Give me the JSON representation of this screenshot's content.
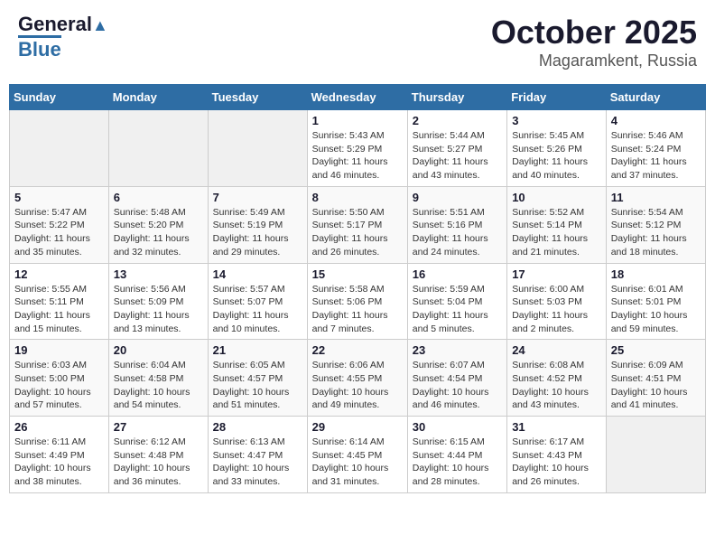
{
  "header": {
    "logo_general": "General",
    "logo_blue": "Blue",
    "title": "October 2025",
    "subtitle": "Magaramkent, Russia"
  },
  "days_of_week": [
    "Sunday",
    "Monday",
    "Tuesday",
    "Wednesday",
    "Thursday",
    "Friday",
    "Saturday"
  ],
  "weeks": [
    [
      {
        "day": "",
        "info": ""
      },
      {
        "day": "",
        "info": ""
      },
      {
        "day": "",
        "info": ""
      },
      {
        "day": "1",
        "info": "Sunrise: 5:43 AM\nSunset: 5:29 PM\nDaylight: 11 hours and 46 minutes."
      },
      {
        "day": "2",
        "info": "Sunrise: 5:44 AM\nSunset: 5:27 PM\nDaylight: 11 hours and 43 minutes."
      },
      {
        "day": "3",
        "info": "Sunrise: 5:45 AM\nSunset: 5:26 PM\nDaylight: 11 hours and 40 minutes."
      },
      {
        "day": "4",
        "info": "Sunrise: 5:46 AM\nSunset: 5:24 PM\nDaylight: 11 hours and 37 minutes."
      }
    ],
    [
      {
        "day": "5",
        "info": "Sunrise: 5:47 AM\nSunset: 5:22 PM\nDaylight: 11 hours and 35 minutes."
      },
      {
        "day": "6",
        "info": "Sunrise: 5:48 AM\nSunset: 5:20 PM\nDaylight: 11 hours and 32 minutes."
      },
      {
        "day": "7",
        "info": "Sunrise: 5:49 AM\nSunset: 5:19 PM\nDaylight: 11 hours and 29 minutes."
      },
      {
        "day": "8",
        "info": "Sunrise: 5:50 AM\nSunset: 5:17 PM\nDaylight: 11 hours and 26 minutes."
      },
      {
        "day": "9",
        "info": "Sunrise: 5:51 AM\nSunset: 5:16 PM\nDaylight: 11 hours and 24 minutes."
      },
      {
        "day": "10",
        "info": "Sunrise: 5:52 AM\nSunset: 5:14 PM\nDaylight: 11 hours and 21 minutes."
      },
      {
        "day": "11",
        "info": "Sunrise: 5:54 AM\nSunset: 5:12 PM\nDaylight: 11 hours and 18 minutes."
      }
    ],
    [
      {
        "day": "12",
        "info": "Sunrise: 5:55 AM\nSunset: 5:11 PM\nDaylight: 11 hours and 15 minutes."
      },
      {
        "day": "13",
        "info": "Sunrise: 5:56 AM\nSunset: 5:09 PM\nDaylight: 11 hours and 13 minutes."
      },
      {
        "day": "14",
        "info": "Sunrise: 5:57 AM\nSunset: 5:07 PM\nDaylight: 11 hours and 10 minutes."
      },
      {
        "day": "15",
        "info": "Sunrise: 5:58 AM\nSunset: 5:06 PM\nDaylight: 11 hours and 7 minutes."
      },
      {
        "day": "16",
        "info": "Sunrise: 5:59 AM\nSunset: 5:04 PM\nDaylight: 11 hours and 5 minutes."
      },
      {
        "day": "17",
        "info": "Sunrise: 6:00 AM\nSunset: 5:03 PM\nDaylight: 11 hours and 2 minutes."
      },
      {
        "day": "18",
        "info": "Sunrise: 6:01 AM\nSunset: 5:01 PM\nDaylight: 10 hours and 59 minutes."
      }
    ],
    [
      {
        "day": "19",
        "info": "Sunrise: 6:03 AM\nSunset: 5:00 PM\nDaylight: 10 hours and 57 minutes."
      },
      {
        "day": "20",
        "info": "Sunrise: 6:04 AM\nSunset: 4:58 PM\nDaylight: 10 hours and 54 minutes."
      },
      {
        "day": "21",
        "info": "Sunrise: 6:05 AM\nSunset: 4:57 PM\nDaylight: 10 hours and 51 minutes."
      },
      {
        "day": "22",
        "info": "Sunrise: 6:06 AM\nSunset: 4:55 PM\nDaylight: 10 hours and 49 minutes."
      },
      {
        "day": "23",
        "info": "Sunrise: 6:07 AM\nSunset: 4:54 PM\nDaylight: 10 hours and 46 minutes."
      },
      {
        "day": "24",
        "info": "Sunrise: 6:08 AM\nSunset: 4:52 PM\nDaylight: 10 hours and 43 minutes."
      },
      {
        "day": "25",
        "info": "Sunrise: 6:09 AM\nSunset: 4:51 PM\nDaylight: 10 hours and 41 minutes."
      }
    ],
    [
      {
        "day": "26",
        "info": "Sunrise: 6:11 AM\nSunset: 4:49 PM\nDaylight: 10 hours and 38 minutes."
      },
      {
        "day": "27",
        "info": "Sunrise: 6:12 AM\nSunset: 4:48 PM\nDaylight: 10 hours and 36 minutes."
      },
      {
        "day": "28",
        "info": "Sunrise: 6:13 AM\nSunset: 4:47 PM\nDaylight: 10 hours and 33 minutes."
      },
      {
        "day": "29",
        "info": "Sunrise: 6:14 AM\nSunset: 4:45 PM\nDaylight: 10 hours and 31 minutes."
      },
      {
        "day": "30",
        "info": "Sunrise: 6:15 AM\nSunset: 4:44 PM\nDaylight: 10 hours and 28 minutes."
      },
      {
        "day": "31",
        "info": "Sunrise: 6:17 AM\nSunset: 4:43 PM\nDaylight: 10 hours and 26 minutes."
      },
      {
        "day": "",
        "info": ""
      }
    ]
  ]
}
